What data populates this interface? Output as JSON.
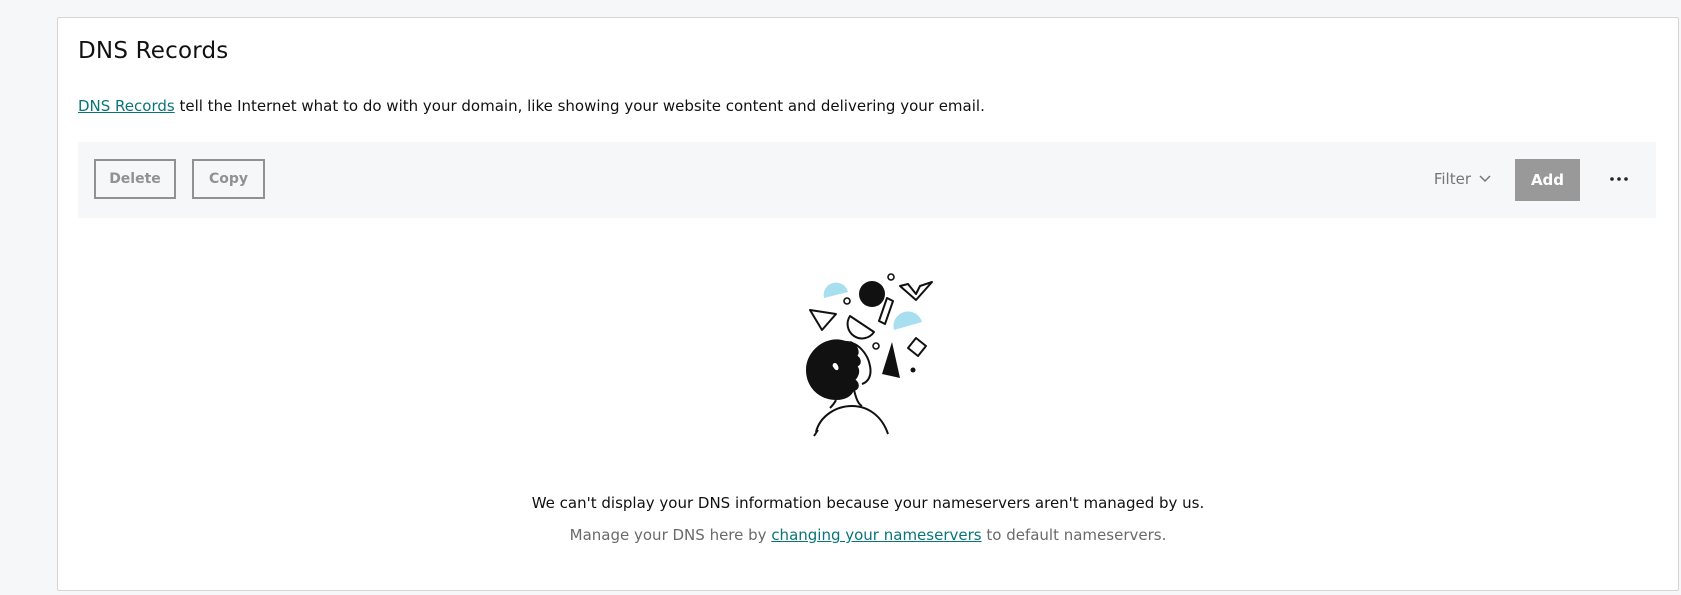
{
  "page": {
    "title": "DNS Records",
    "intro_link": "DNS Records",
    "intro_rest": " tell the Internet what to do with your domain, like showing your website content and delivering your email."
  },
  "toolbar": {
    "delete_label": "Delete",
    "copy_label": "Copy",
    "filter_label": "Filter",
    "add_label": "Add",
    "more_icon": "more-horizontal-icon"
  },
  "empty_state": {
    "message": "We can't display your DNS information because your nameservers aren't managed by us.",
    "sub_prefix": "Manage your DNS here by ",
    "sub_link": "changing your nameservers",
    "sub_suffix": " to default nameservers."
  },
  "colors": {
    "link": "#09757a",
    "toolbar_bg": "#f5f7f8",
    "add_button": "#999999",
    "accent_shape": "#a8dff0"
  }
}
